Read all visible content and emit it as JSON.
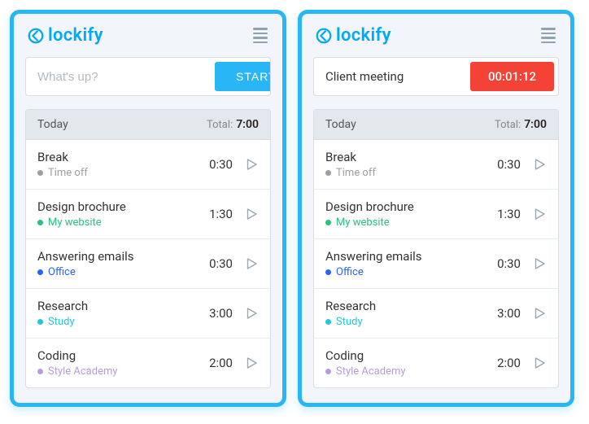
{
  "brand": "lockify",
  "left": {
    "input_placeholder": "What's up?",
    "start_label": "START"
  },
  "right": {
    "running_task": "Client meeting",
    "elapsed": "00:01:12"
  },
  "list": {
    "header_label": "Today",
    "total_label": "Total:",
    "total_value": "7:00",
    "entries": [
      {
        "title": "Break",
        "project": "Time off",
        "color": "#9e9e9e",
        "time": "0:30"
      },
      {
        "title": "Design brochure",
        "project": "My website",
        "color": "#26c281",
        "time": "1:30"
      },
      {
        "title": "Answering emails",
        "project": "Office",
        "color": "#2962ff",
        "time": "0:30"
      },
      {
        "title": "Research",
        "project": "Study",
        "color": "#26c6da",
        "time": "3:00"
      },
      {
        "title": "Coding",
        "project": "Style Academy",
        "color": "#b39ddb",
        "time": "2:00"
      }
    ]
  }
}
